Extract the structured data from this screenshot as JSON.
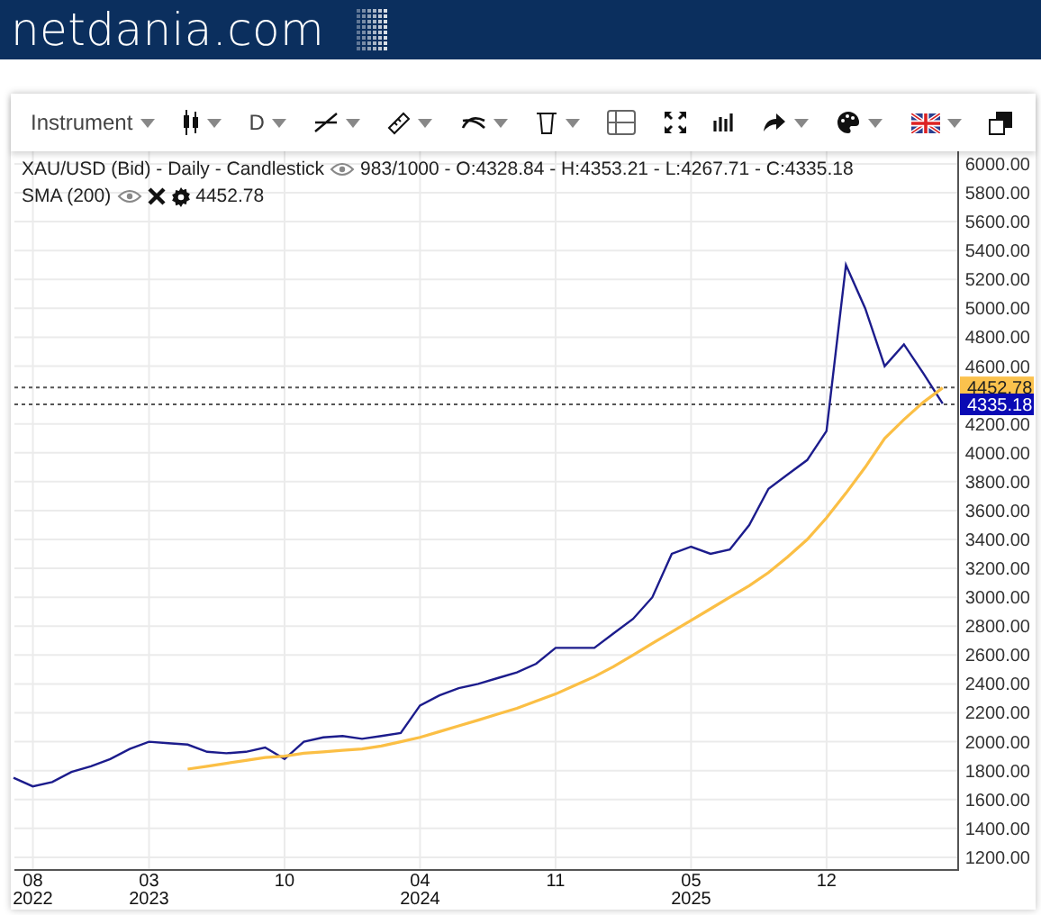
{
  "header": {
    "logo": "netdania.com"
  },
  "toolbar": [
    {
      "label": "Instrument",
      "dropdown": true
    },
    {
      "dropdown": true
    },
    {
      "label": "D",
      "dropdown": true
    },
    {
      "dropdown": true
    },
    {
      "dropdown": true
    },
    {
      "dropdown": true
    },
    {
      "dropdown": true
    },
    {
      "dropdown": false
    },
    {
      "dropdown": false
    },
    {
      "dropdown": false
    },
    {
      "dropdown": true
    },
    {
      "dropdown": true
    },
    {
      "dropdown": true
    },
    {
      "dropdown": false
    }
  ],
  "legend": {
    "main": {
      "stats": "983/1000 - O:4328.84 - H:4353.21 - L:4267.71 - C:4335.18"
    },
    "indicator": {
      "value": "4452.78"
    }
  },
  "price_markers": [
    {
      "color": "#fbc24d"
    },
    {
      "color": "#0a0ab4"
    }
  ],
  "chart": {
    "chart_data": {
      "type": "line",
      "grid": true,
      "ylim": [
        1112,
        6087
      ],
      "categories": [
        null,
        "08 2022",
        null,
        null,
        null,
        null,
        null,
        "03 2023",
        null,
        null,
        null,
        null,
        null,
        null,
        "10",
        null,
        null,
        null,
        null,
        null,
        null,
        "04 2024",
        null,
        null,
        null,
        null,
        null,
        null,
        "11",
        null,
        null,
        null,
        null,
        null,
        null,
        "05 2025",
        null,
        null,
        null,
        null,
        null,
        null,
        "12",
        null,
        null,
        null,
        null,
        null,
        null
      ],
      "series": [
        {
          "name": "XAU/USD (Bid) - Daily - Candlestick",
          "color": "#1c1c8c",
          "values": [
            1750,
            1690,
            1720,
            1790,
            1830,
            1880,
            1950,
            2000,
            1990,
            1980,
            1930,
            1920,
            1930,
            1960,
            1880,
            2000,
            2030,
            2040,
            2020,
            2040,
            2060,
            2250,
            2320,
            2370,
            2400,
            2440,
            2480,
            2540,
            2650,
            2650,
            2650,
            2750,
            2850,
            3000,
            3300,
            3350,
            3300,
            3330,
            3500,
            3750,
            3850,
            3950,
            4150,
            5300,
            5000,
            4600,
            4750,
            4550,
            4340
          ]
        },
        {
          "name": "SMA (200)",
          "color": "#fbbf45",
          "values": [
            null,
            null,
            null,
            null,
            null,
            null,
            null,
            null,
            null,
            1810,
            1830,
            1850,
            1870,
            1890,
            1900,
            1920,
            1930,
            1940,
            1950,
            1970,
            2000,
            2030,
            2070,
            2110,
            2150,
            2190,
            2230,
            2280,
            2330,
            2390,
            2450,
            2520,
            2600,
            2680,
            2760,
            2840,
            2920,
            3000,
            3080,
            3170,
            3280,
            3400,
            3550,
            3720,
            3900,
            4100,
            4230,
            4350,
            4450
          ]
        }
      ],
      "yticks": [
        {
          "value": 1200,
          "label": "1200.00"
        },
        {
          "value": 1400,
          "label": "1400.00"
        },
        {
          "value": 1600,
          "label": "1600.00"
        },
        {
          "value": 1800,
          "label": "1800.00"
        },
        {
          "value": 2000,
          "label": "2000.00"
        },
        {
          "value": 2200,
          "label": "2200.00"
        },
        {
          "value": 2400,
          "label": "2400.00"
        },
        {
          "value": 2600,
          "label": "2600.00"
        },
        {
          "value": 2800,
          "label": "2800.00"
        },
        {
          "value": 3000,
          "label": "3000.00"
        },
        {
          "value": 3200,
          "label": "3200.00"
        },
        {
          "value": 3400,
          "label": "3400.00"
        },
        {
          "value": 3600,
          "label": "3600.00"
        },
        {
          "value": 3800,
          "label": "3800.00"
        },
        {
          "value": 4000,
          "label": "4000.00"
        },
        {
          "value": 4200,
          "label": "4200.00"
        },
        {
          "value": 4600,
          "label": "4600.00"
        },
        {
          "value": 4800,
          "label": "4800.00"
        },
        {
          "value": 5000,
          "label": "5000.00"
        },
        {
          "value": 5200,
          "label": "5200.00"
        },
        {
          "value": 5400,
          "label": "5400.00"
        },
        {
          "value": 5600,
          "label": "5600.00"
        },
        {
          "value": 5800,
          "label": "5800.00"
        },
        {
          "value": 6000,
          "label": "6000.00"
        }
      ],
      "ref_lines": [
        {
          "axis": "y",
          "value": 4452.78,
          "label": "4452.78"
        },
        {
          "axis": "y",
          "value": 4335.18,
          "label": "4335.18"
        }
      ]
    }
  }
}
